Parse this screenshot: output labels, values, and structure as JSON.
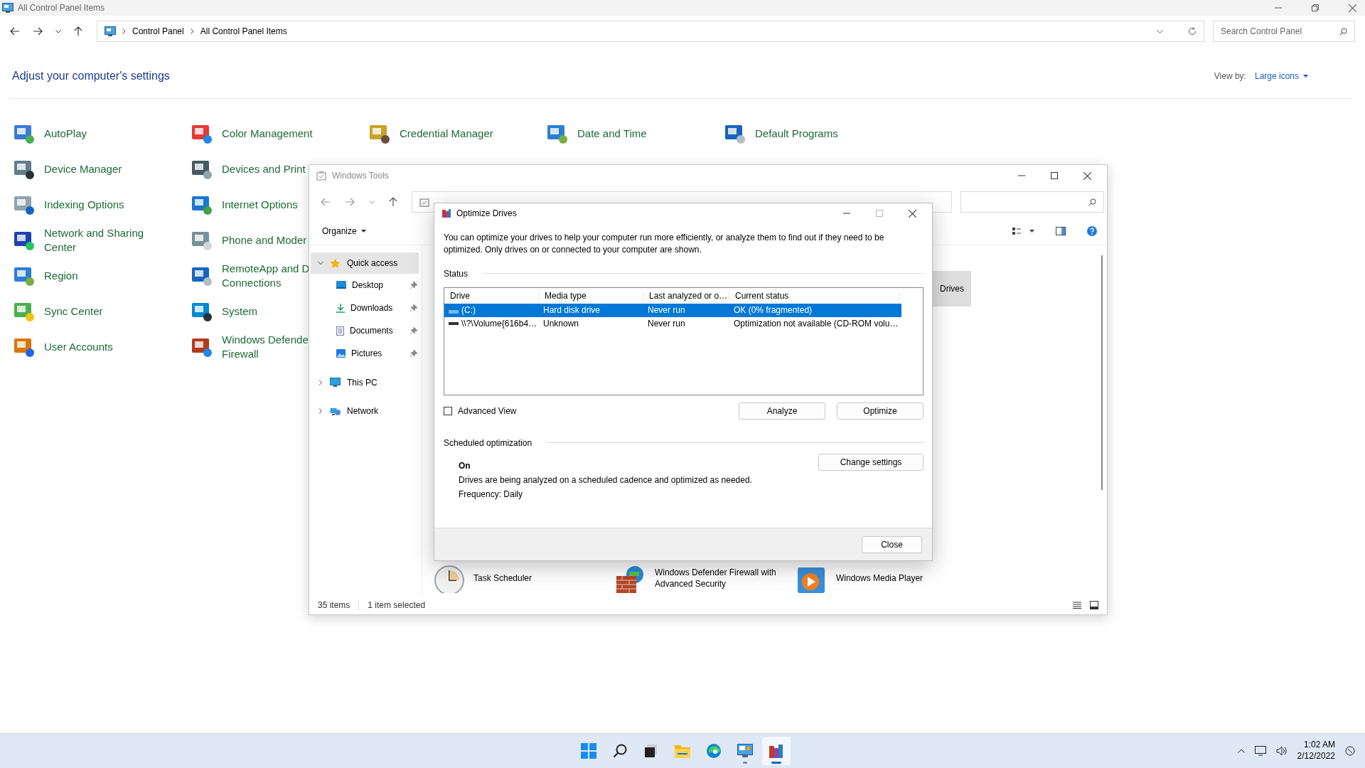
{
  "window": {
    "title": "All Control Panel Items"
  },
  "address_bar": {
    "path": [
      "Control Panel",
      "All Control Panel Items"
    ]
  },
  "search": {
    "placeholder": "Search Control Panel"
  },
  "heading": "Adjust your computer's settings",
  "view_by": {
    "label": "View by:",
    "value": "Large icons"
  },
  "columns": [
    [
      {
        "label": "AutoPlay"
      },
      {
        "label": "Device Manager"
      },
      {
        "label": "Indexing Options"
      },
      {
        "label": "Network and Sharing\nCenter"
      },
      {
        "label": "Region"
      },
      {
        "label": "Sync Center"
      },
      {
        "label": "User Accounts"
      }
    ],
    [
      {
        "label": "Color Management"
      },
      {
        "label": "Devices and Print"
      },
      {
        "label": "Internet Options"
      },
      {
        "label": "Phone and Moder"
      },
      {
        "label": "RemoteApp and D\nConnections"
      },
      {
        "label": "System"
      },
      {
        "label": "Windows Defende\nFirewall"
      }
    ],
    [
      {
        "label": "Credential Manager"
      }
    ],
    [
      {
        "label": "Date and Time"
      }
    ],
    [
      {
        "label": "Default Programs"
      }
    ]
  ],
  "tools_window": {
    "title": "Windows Tools",
    "organize": "Organize",
    "nav": [
      {
        "label": "Quick access",
        "expanded": true,
        "selected": true,
        "children": [
          {
            "label": "Desktop",
            "pinned": true
          },
          {
            "label": "Downloads",
            "pinned": true
          },
          {
            "label": "Documents",
            "pinned": true
          },
          {
            "label": "Pictures",
            "pinned": true
          }
        ]
      },
      {
        "label": "This PC",
        "expanded": false,
        "selected": false
      },
      {
        "label": "Network",
        "expanded": false,
        "selected": false
      }
    ],
    "items": [
      {
        "label": "Drives",
        "selected": true
      },
      {
        "label": "Task Scheduler",
        "selected": false
      },
      {
        "label": "Windows Defender Firewall with Advanced Security",
        "selected": false
      },
      {
        "label": "Windows Media Player",
        "selected": false
      }
    ],
    "status": [
      "35 items",
      "1 item selected"
    ]
  },
  "optimize_dialog": {
    "title": "Optimize Drives",
    "intro": "You can optimize your drives to help your computer run more efficiently, or analyze them to find out if they need to be optimized. Only drives on or connected to your computer are shown.",
    "status_label": "Status",
    "columns": [
      "Drive",
      "Media type",
      "Last analyzed or o…",
      "Current status"
    ],
    "rows": [
      {
        "kind": "hdd",
        "selected": true,
        "cells": [
          "(C:)",
          "Hard disk drive",
          "Never run",
          "OK (0% fragmented)"
        ]
      },
      {
        "kind": "optical",
        "selected": false,
        "cells": [
          "\\\\?\\Volume{616b4…",
          "Unknown",
          "Never run",
          "Optimization not available (CD-ROM volu…"
        ]
      }
    ],
    "advanced_view": {
      "label": "Advanced View",
      "checked": false
    },
    "buttons": [
      "Analyze",
      "Optimize"
    ],
    "schedule": {
      "label": "Scheduled optimization",
      "state": "On",
      "description": "Drives are being analyzed on a scheduled cadence and optimized as needed.",
      "frequency": "Frequency: Daily",
      "button": "Change settings"
    },
    "close": "Close"
  },
  "taskbar": {
    "apps": [
      {
        "kind": "start",
        "running": false,
        "selected": false
      },
      {
        "kind": "search",
        "running": false,
        "selected": false
      },
      {
        "kind": "taskview",
        "running": false,
        "selected": false
      },
      {
        "kind": "explorer",
        "running": false,
        "selected": false
      },
      {
        "kind": "edge",
        "running": false,
        "selected": false
      },
      {
        "kind": "control",
        "running": true,
        "selected": false
      },
      {
        "kind": "defrag",
        "running": true,
        "selected": true
      }
    ],
    "time": "1:02 AM",
    "date": "2/12/2022"
  }
}
